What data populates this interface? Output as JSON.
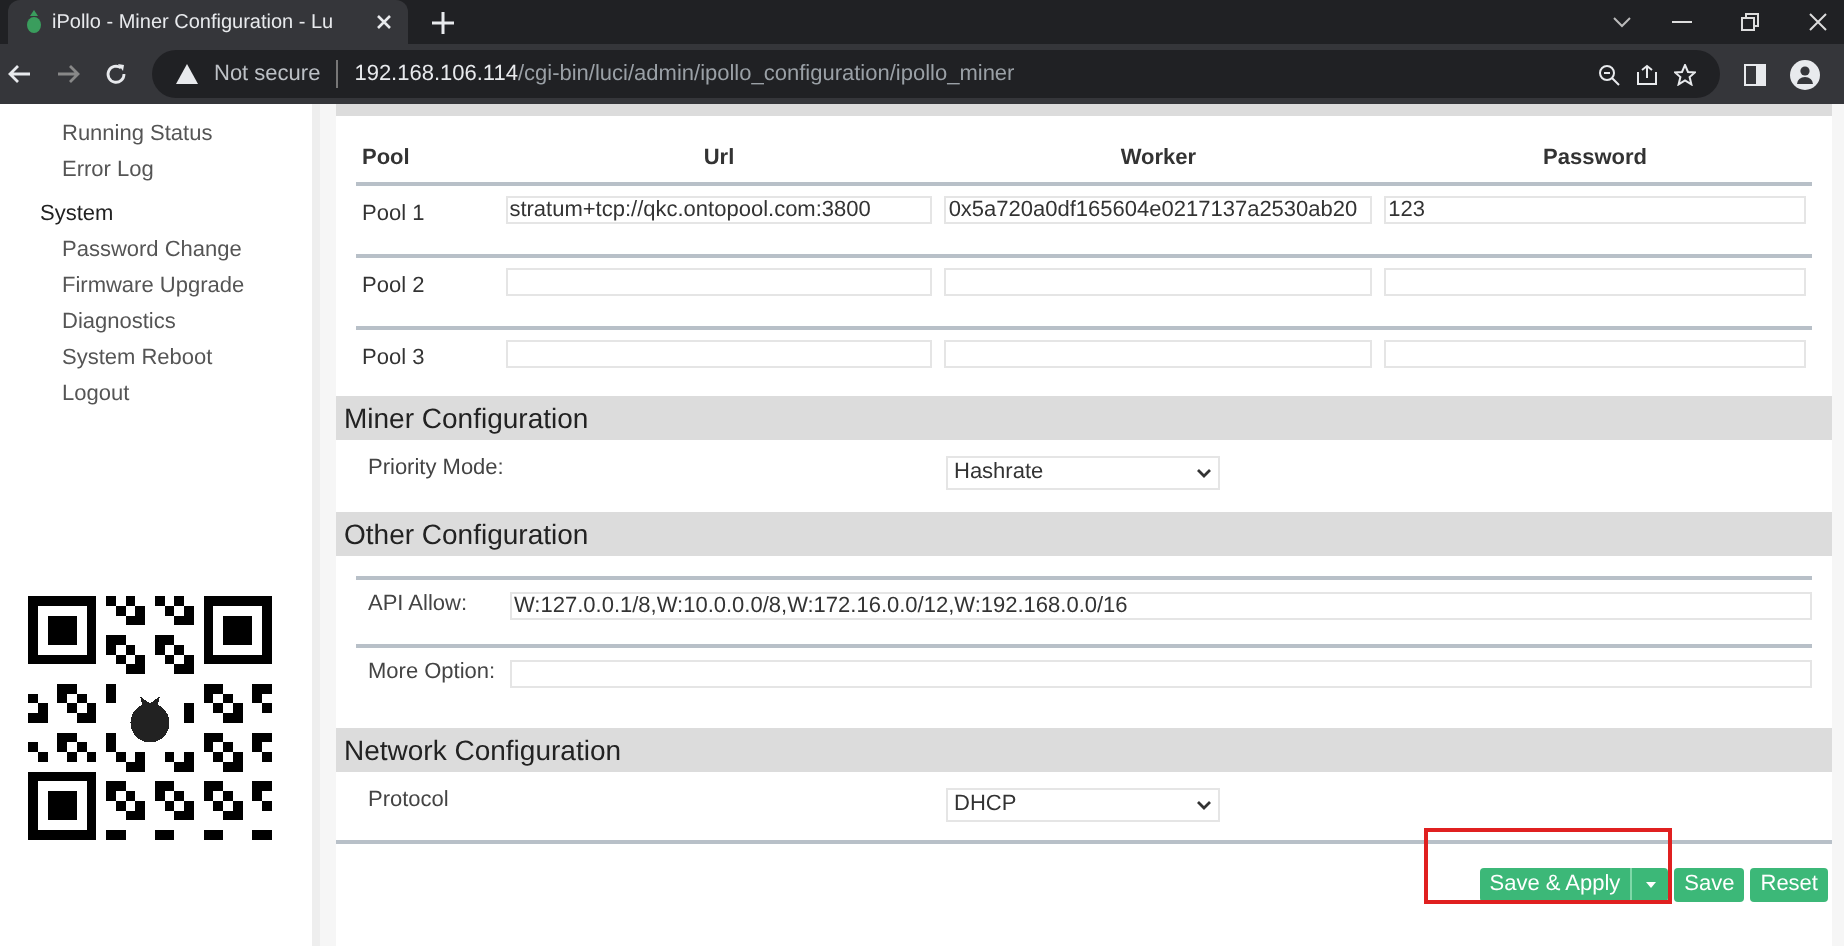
{
  "browser": {
    "tab_title": "iPollo - Miner Configuration - Lu",
    "security_label": "Not secure",
    "url_host": "192.168.106.114",
    "url_path": "/cgi-bin/luci/admin/ipollo_configuration/ipollo_miner"
  },
  "sidebar": {
    "groups": [
      {
        "items": [
          "Running Status",
          "Error Log"
        ]
      },
      {
        "heading": "System",
        "items": [
          "Password Change",
          "Firmware Upgrade",
          "Diagnostics",
          "System Reboot",
          "Logout"
        ]
      }
    ]
  },
  "pool_table": {
    "columns": [
      "Pool",
      "Url",
      "Worker",
      "Password"
    ],
    "rows": [
      {
        "pool": "Pool 1",
        "url": "stratum+tcp://qkc.ontopool.com:3800",
        "worker": "0x5a720a0df165604e0217137a2530ab20",
        "password": "123"
      },
      {
        "pool": "Pool 2",
        "url": "",
        "worker": "",
        "password": ""
      },
      {
        "pool": "Pool 3",
        "url": "",
        "worker": "",
        "password": ""
      }
    ]
  },
  "sections": [
    {
      "title": "Miner Configuration",
      "fields": [
        {
          "label": "Priority Mode:",
          "kind": "select",
          "value": "Hashrate"
        }
      ]
    },
    {
      "title": "Other Configuration",
      "fields": [
        {
          "label": "API Allow:",
          "kind": "input",
          "value": "W:127.0.0.1/8,W:10.0.0.0/8,W:172.16.0.0/12,W:192.168.0.0/16"
        },
        {
          "label": "More Option:",
          "kind": "input"
        }
      ]
    },
    {
      "title": "Network Configuration",
      "fields": [
        {
          "label": "Protocol",
          "kind": "select",
          "value": "DHCP"
        }
      ]
    }
  ],
  "buttons": [
    {
      "label": "Save & Apply",
      "kind": "split"
    },
    {
      "label": "Save",
      "kind": "plain"
    },
    {
      "label": "Reset",
      "kind": "plain"
    }
  ]
}
